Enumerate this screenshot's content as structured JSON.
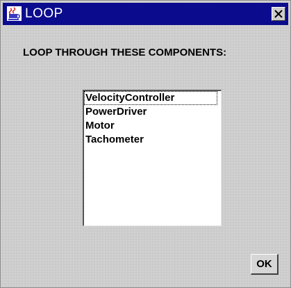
{
  "window": {
    "title": "LOOP",
    "app_icon": "java-coffee-cup-icon",
    "close_icon": "close-icon"
  },
  "dialog": {
    "prompt": "LOOP THROUGH THESE COMPONENTS:",
    "components": [
      "VelocityController",
      "PowerDriver",
      "Motor",
      "Tachometer"
    ],
    "focused_index": 0,
    "ok_label": "OK"
  },
  "colors": {
    "titlebar": "#0b0b8e",
    "panel": "#cdcdcd",
    "list_background": "#ffffff"
  }
}
